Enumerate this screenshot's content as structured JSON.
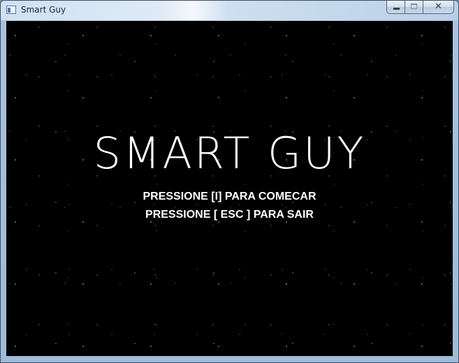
{
  "window": {
    "title": "Smart Guy",
    "close_glyph": "✕",
    "icons": {
      "app": "app-window-icon",
      "minimize": "minimize-icon",
      "maximize": "maximize-icon",
      "close": "close-icon"
    }
  },
  "game": {
    "title": "SMART GUY",
    "prompts": {
      "start": "PRESSIONE [I] PARA COMECAR",
      "exit": "PRESSIONE [ ESC ] PARA SAIR"
    }
  },
  "colors": {
    "background": "#000000",
    "text": "#ffffff",
    "window_frame": "#a9c3de"
  }
}
